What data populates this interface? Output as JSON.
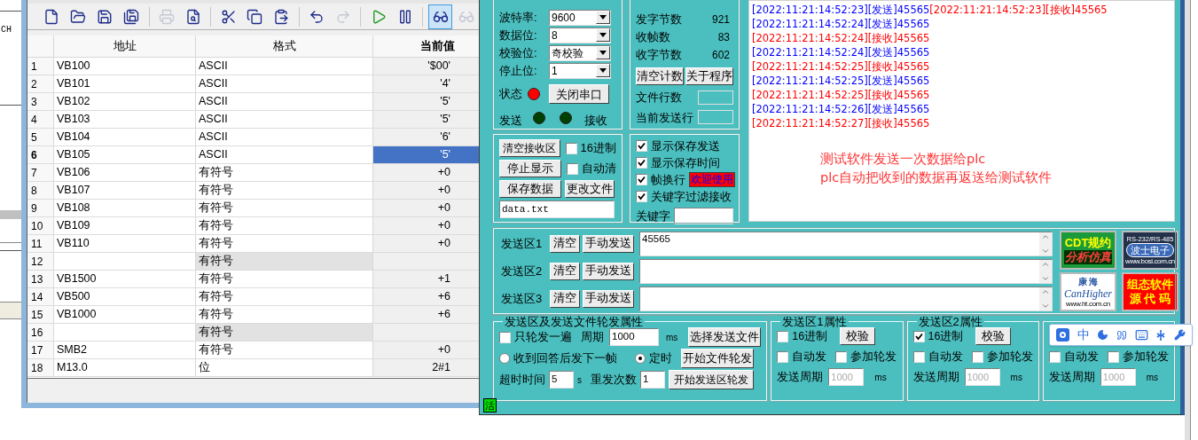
{
  "background_app": {
    "text": "CH"
  },
  "toolbar": [
    {
      "kind": "new",
      "selected": false,
      "disabled": false
    },
    {
      "kind": "open",
      "selected": false,
      "disabled": false
    },
    {
      "kind": "save",
      "selected": false,
      "disabled": false
    },
    {
      "kind": "save_all",
      "selected": false,
      "disabled": false
    },
    {
      "kind": "print",
      "selected": false,
      "disabled": true
    },
    {
      "kind": "preview",
      "selected": false,
      "disabled": false
    },
    {
      "kind": "cut",
      "selected": false,
      "disabled": false
    },
    {
      "kind": "copy",
      "selected": false,
      "disabled": false
    },
    {
      "kind": "paste",
      "selected": false,
      "disabled": false
    },
    {
      "kind": "undo",
      "selected": false,
      "disabled": false
    },
    {
      "kind": "redo",
      "selected": false,
      "disabled": true
    },
    {
      "kind": "run",
      "selected": false,
      "disabled": false
    },
    {
      "kind": "pause",
      "selected": false,
      "disabled": false
    },
    {
      "kind": "monitor",
      "selected": true,
      "disabled": false
    },
    {
      "kind": "monitor",
      "selected": false,
      "disabled": true
    }
  ],
  "table": {
    "columns": [
      "地址",
      "格式",
      "当前值"
    ],
    "rows": [
      {
        "num": "1",
        "address": "VB100",
        "format": "ASCII",
        "value": "'$00'",
        "selected": false,
        "shaded": false
      },
      {
        "num": "2",
        "address": "VB101",
        "format": "ASCII",
        "value": "'4'",
        "selected": false,
        "shaded": false
      },
      {
        "num": "3",
        "address": "VB102",
        "format": "ASCII",
        "value": "'5'",
        "selected": false,
        "shaded": false
      },
      {
        "num": "4",
        "address": "VB103",
        "format": "ASCII",
        "value": "'5'",
        "selected": false,
        "shaded": false
      },
      {
        "num": "5",
        "address": "VB104",
        "format": "ASCII",
        "value": "'6'",
        "selected": false,
        "shaded": false
      },
      {
        "num": "6",
        "address": "VB105",
        "format": "ASCII",
        "value": "'5'",
        "selected": true,
        "shaded": false
      },
      {
        "num": "7",
        "address": "VB106",
        "format": "有符号",
        "value": "+0",
        "selected": false,
        "shaded": false
      },
      {
        "num": "8",
        "address": "VB107",
        "format": "有符号",
        "value": "+0",
        "selected": false,
        "shaded": false
      },
      {
        "num": "9",
        "address": "VB108",
        "format": "有符号",
        "value": "+0",
        "selected": false,
        "shaded": false
      },
      {
        "num": "10",
        "address": "VB109",
        "format": "有符号",
        "value": "+0",
        "selected": false,
        "shaded": false
      },
      {
        "num": "11",
        "address": "VB110",
        "format": "有符号",
        "value": "+0",
        "selected": false,
        "shaded": false
      },
      {
        "num": "12",
        "format": "有符号",
        "selected": false,
        "shaded": true
      },
      {
        "num": "13",
        "address": "VB1500",
        "format": "有符号",
        "value": "+1",
        "selected": false,
        "shaded": false
      },
      {
        "num": "14",
        "address": "VB500",
        "format": "有符号",
        "value": "+6",
        "selected": false,
        "shaded": false
      },
      {
        "num": "15",
        "address": "VB1000",
        "format": "有符号",
        "value": "+6",
        "selected": false,
        "shaded": false
      },
      {
        "num": "16",
        "format": "有符号",
        "selected": false,
        "shaded": true
      },
      {
        "num": "17",
        "address": "SMB2",
        "format": "有符号",
        "value": "+0",
        "selected": false,
        "shaded": false
      },
      {
        "num": "18",
        "address": "M13.0",
        "format": "位",
        "value": "2#1",
        "selected": false,
        "shaded": false
      }
    ]
  },
  "serial": {
    "fields": [
      {
        "label": "波特率:",
        "value": "9600"
      },
      {
        "label": "数据位:",
        "value": "8"
      },
      {
        "label": "校验位:",
        "value": "奇校验"
      },
      {
        "label": "停止位:",
        "value": "1"
      }
    ],
    "status": {
      "label": "状态",
      "on": true
    },
    "port_button": "关闭串口",
    "send_lamp": {
      "label": "发送",
      "on": false
    },
    "receive_lamp": {
      "label": "接收",
      "on": false
    }
  },
  "stats": {
    "items": [
      {
        "label": "发字节数",
        "value": "921"
      },
      {
        "label": "收帧数",
        "value": "83"
      },
      {
        "label": "收字节数",
        "value": "602"
      }
    ],
    "buttons": [
      "清空计数",
      "关于程序"
    ],
    "file_lines_label": "文件行数",
    "current_line_label": "当前发送行"
  },
  "receive_options": {
    "clear_button": "清空接收区",
    "hex": {
      "label": "16进制",
      "checked": false
    },
    "stop_button": "停止显示",
    "auto_clear": {
      "label": "自动清",
      "checked": false
    },
    "save_button": "保存数据",
    "change_file_button": "更改文件",
    "file": "data.txt"
  },
  "display_options": {
    "checks": [
      {
        "label": "显示保存发送",
        "checked": true
      },
      {
        "label": "显示保存时间",
        "checked": true
      },
      {
        "label": "帧换行",
        "checked": true
      },
      {
        "label": "关键字过滤接收",
        "checked": true
      }
    ],
    "banner": "欢迎使用",
    "keyword_label": "关键字"
  },
  "log": {
    "lines": [
      [
        {
          "text": "[2022:11:21:14:52:23][发送]45565",
          "kind": "send"
        },
        {
          "text": "[2022:11:21:14:52:23][接收]45565",
          "kind": "receive"
        }
      ],
      [
        {
          "text": "[2022:11:21:14:52:24][发送]45565",
          "kind": "send"
        }
      ],
      [
        {
          "text": "[2022:11:21:14:52:24][接收]45565",
          "kind": "receive"
        }
      ],
      [
        {
          "text": "[2022:11:21:14:52:24][发送]45565",
          "kind": "send"
        }
      ],
      [
        {
          "text": "[2022:11:21:14:52:25][接收]45565",
          "kind": "receive"
        }
      ],
      [
        {
          "text": "[2022:11:21:14:52:25][发送]45565",
          "kind": "send"
        }
      ],
      [
        {
          "text": "[2022:11:21:14:52:25][接收]45565",
          "kind": "receive"
        }
      ],
      [
        {
          "text": "[2022:11:21:14:52:26][发送]45565",
          "kind": "send"
        }
      ],
      [
        {
          "text": "[2022:11:21:14:52:27][接收]45565",
          "kind": "receive"
        }
      ]
    ],
    "annotation": [
      "测试软件发送一次数据给plc",
      "plc自动把收到的数据再返送给测试软件"
    ]
  },
  "send_area": {
    "rows": [
      {
        "label": "发送区1",
        "clear": "清空",
        "send": "手动发送",
        "value": "45565"
      },
      {
        "label": "发送区2",
        "clear": "清空",
        "send": "手动发送"
      },
      {
        "label": "发送区3",
        "clear": "清空",
        "send": "手动发送"
      }
    ],
    "logos": [
      {
        "kind": "cdt",
        "lines": [
          "CDT规约",
          "分析仿真"
        ]
      },
      {
        "kind": "bosi",
        "lines": [
          "RS-232/RS-485",
          "波士电子",
          "www.bosi.com.cn"
        ]
      },
      {
        "kind": "canhigher",
        "lines": [
          "康 海",
          "CanHigher",
          "www.ht.com.cn"
        ]
      },
      {
        "kind": "source",
        "lines": [
          "组态软件",
          "源 代 码"
        ]
      }
    ]
  },
  "rotation": {
    "title": "发送区及发送文件轮发属性",
    "once": {
      "label": "只轮发一遍",
      "checked": false
    },
    "period_label": "周期",
    "period": "1000",
    "period_unit": "ms",
    "select_file": "选择发送文件",
    "modes": [
      {
        "label": "收到回答后发下一帧",
        "selected": false
      },
      {
        "label": "定时",
        "selected": true
      }
    ],
    "start_file": "开始文件轮发",
    "timeout_label": "超时时间",
    "timeout": "5",
    "timeout_unit": "s",
    "retry_label": "重发次数",
    "retry": "1",
    "start_area": "开始发送区轮发"
  },
  "zones": [
    {
      "title": "发送区1属性",
      "hex": {
        "label": "16进制",
        "checked": false
      },
      "verify": "校验",
      "auto": {
        "label": "自动发",
        "checked": false
      },
      "rotate": {
        "label": "参加轮发",
        "checked": false
      },
      "period_label": "发送周期",
      "period": "1000",
      "unit": "ms"
    },
    {
      "title": "发送区2属性",
      "hex": {
        "label": "16进制",
        "checked": true
      },
      "verify": "校验",
      "auto": {
        "label": "自动发",
        "checked": false
      },
      "rotate": {
        "label": "参加轮发",
        "checked": false
      },
      "period_label": "发送周期",
      "period": "1000",
      "unit": "ms"
    },
    {
      "auto": {
        "label": "自动发",
        "checked": false
      },
      "rotate": {
        "label": "参加轮发",
        "checked": false
      },
      "period_label": "发送周期",
      "period": "1000",
      "unit": "ms"
    }
  ],
  "active_badge": "活",
  "ime": {
    "mode": "中"
  }
}
